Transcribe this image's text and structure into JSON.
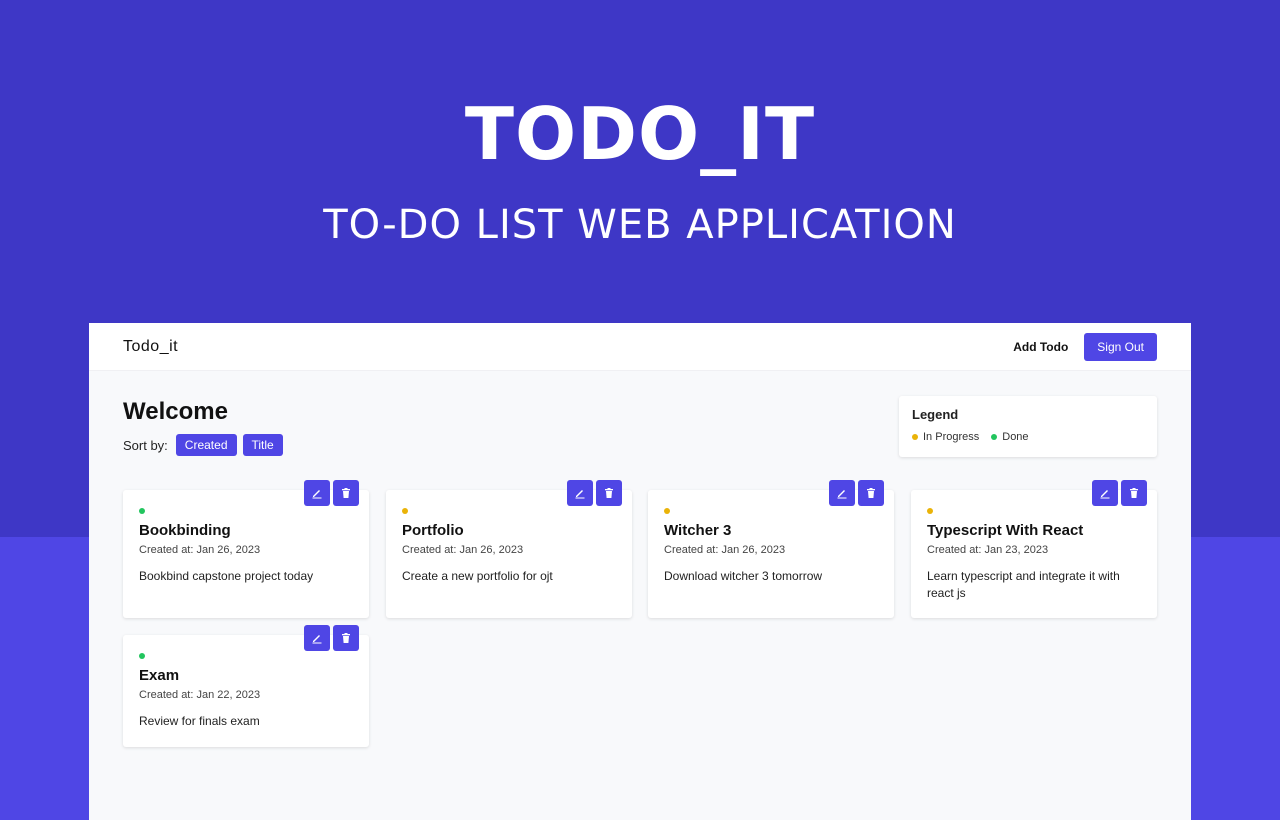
{
  "hero": {
    "title": "TODO_IT",
    "subtitle": "TO-DO LIST WEB APPLICATION"
  },
  "navbar": {
    "brand": "Todo_it",
    "add_todo": "Add Todo",
    "sign_out": "Sign Out"
  },
  "page": {
    "welcome": "Welcome",
    "sort_label": "Sort by:",
    "sort_created": "Created",
    "sort_title": "Title"
  },
  "legend": {
    "title": "Legend",
    "in_progress": "In Progress",
    "done": "Done"
  },
  "todos": [
    {
      "title": "Bookbinding",
      "created": "Created at: Jan 26, 2023",
      "description": "Bookbind capstone project today",
      "status": "done"
    },
    {
      "title": "Portfolio",
      "created": "Created at: Jan 26, 2023",
      "description": "Create a new portfolio for ojt",
      "status": "in-progress"
    },
    {
      "title": "Witcher 3",
      "created": "Created at: Jan 26, 2023",
      "description": "Download witcher 3 tomorrow",
      "status": "in-progress"
    },
    {
      "title": "Typescript With React",
      "created": "Created at: Jan 23, 2023",
      "description": "Learn typescript and integrate it with react js",
      "status": "in-progress"
    },
    {
      "title": "Exam",
      "created": "Created at: Jan 22, 2023",
      "description": "Review for finals exam",
      "status": "done"
    }
  ],
  "colors": {
    "accent": "#4f46e5",
    "in_progress": "#eab308",
    "done": "#22c55e"
  },
  "icons": {
    "edit": "pencil-icon",
    "delete": "trash-icon"
  }
}
